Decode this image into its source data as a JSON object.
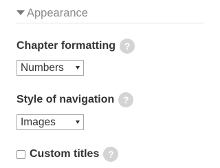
{
  "section": {
    "title": "Appearance",
    "expanded": true
  },
  "fields": {
    "chapter_formatting": {
      "label": "Chapter formatting",
      "help_icon": "?",
      "value": "Numbers"
    },
    "style_of_navigation": {
      "label": "Style of navigation",
      "help_icon": "?",
      "value": "Images"
    },
    "custom_titles": {
      "label": "Custom titles",
      "help_icon": "?",
      "checked": false
    }
  },
  "colors": {
    "text": "#333333",
    "section_title": "#8a8a8a",
    "help_icon_bg": "#d4d4d4",
    "border": "#a9a9a9"
  }
}
